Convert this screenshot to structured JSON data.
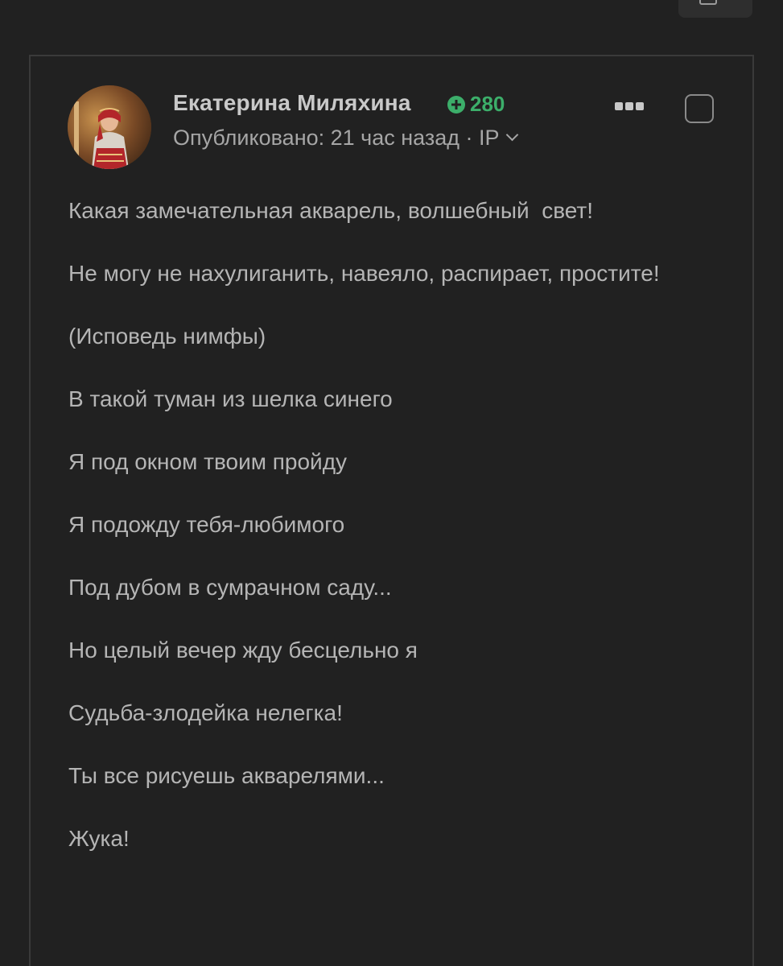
{
  "comment": {
    "author": {
      "name": "Екатерина Миляхина",
      "rating": "280",
      "avatar_icon": "user-avatar-photo"
    },
    "meta": {
      "published": "Опубликовано: 21 час назад · IP"
    },
    "paragraphs": [
      "Какая замечательная акварель, волшебный  свет!",
      "Не могу не нахулиганить, навеяло, распирает, простите!",
      "(Исповедь нимфы)",
      "В такой туман из шелка синего",
      "Я под окном твоим пройду",
      "Я подожду тебя-любимого",
      "Под дубом в сумрачном саду...",
      "Но целый вечер жду бесцельно я",
      "Судьба-злодейка нелегка!",
      "Ты все рисуешь акварелями...",
      "Жука!"
    ]
  },
  "colors": {
    "background": "#212121",
    "card_border": "#3a3a3a",
    "rating_green": "#3cae6a",
    "text": "#b5b5b5",
    "name": "#c9c9c9"
  }
}
